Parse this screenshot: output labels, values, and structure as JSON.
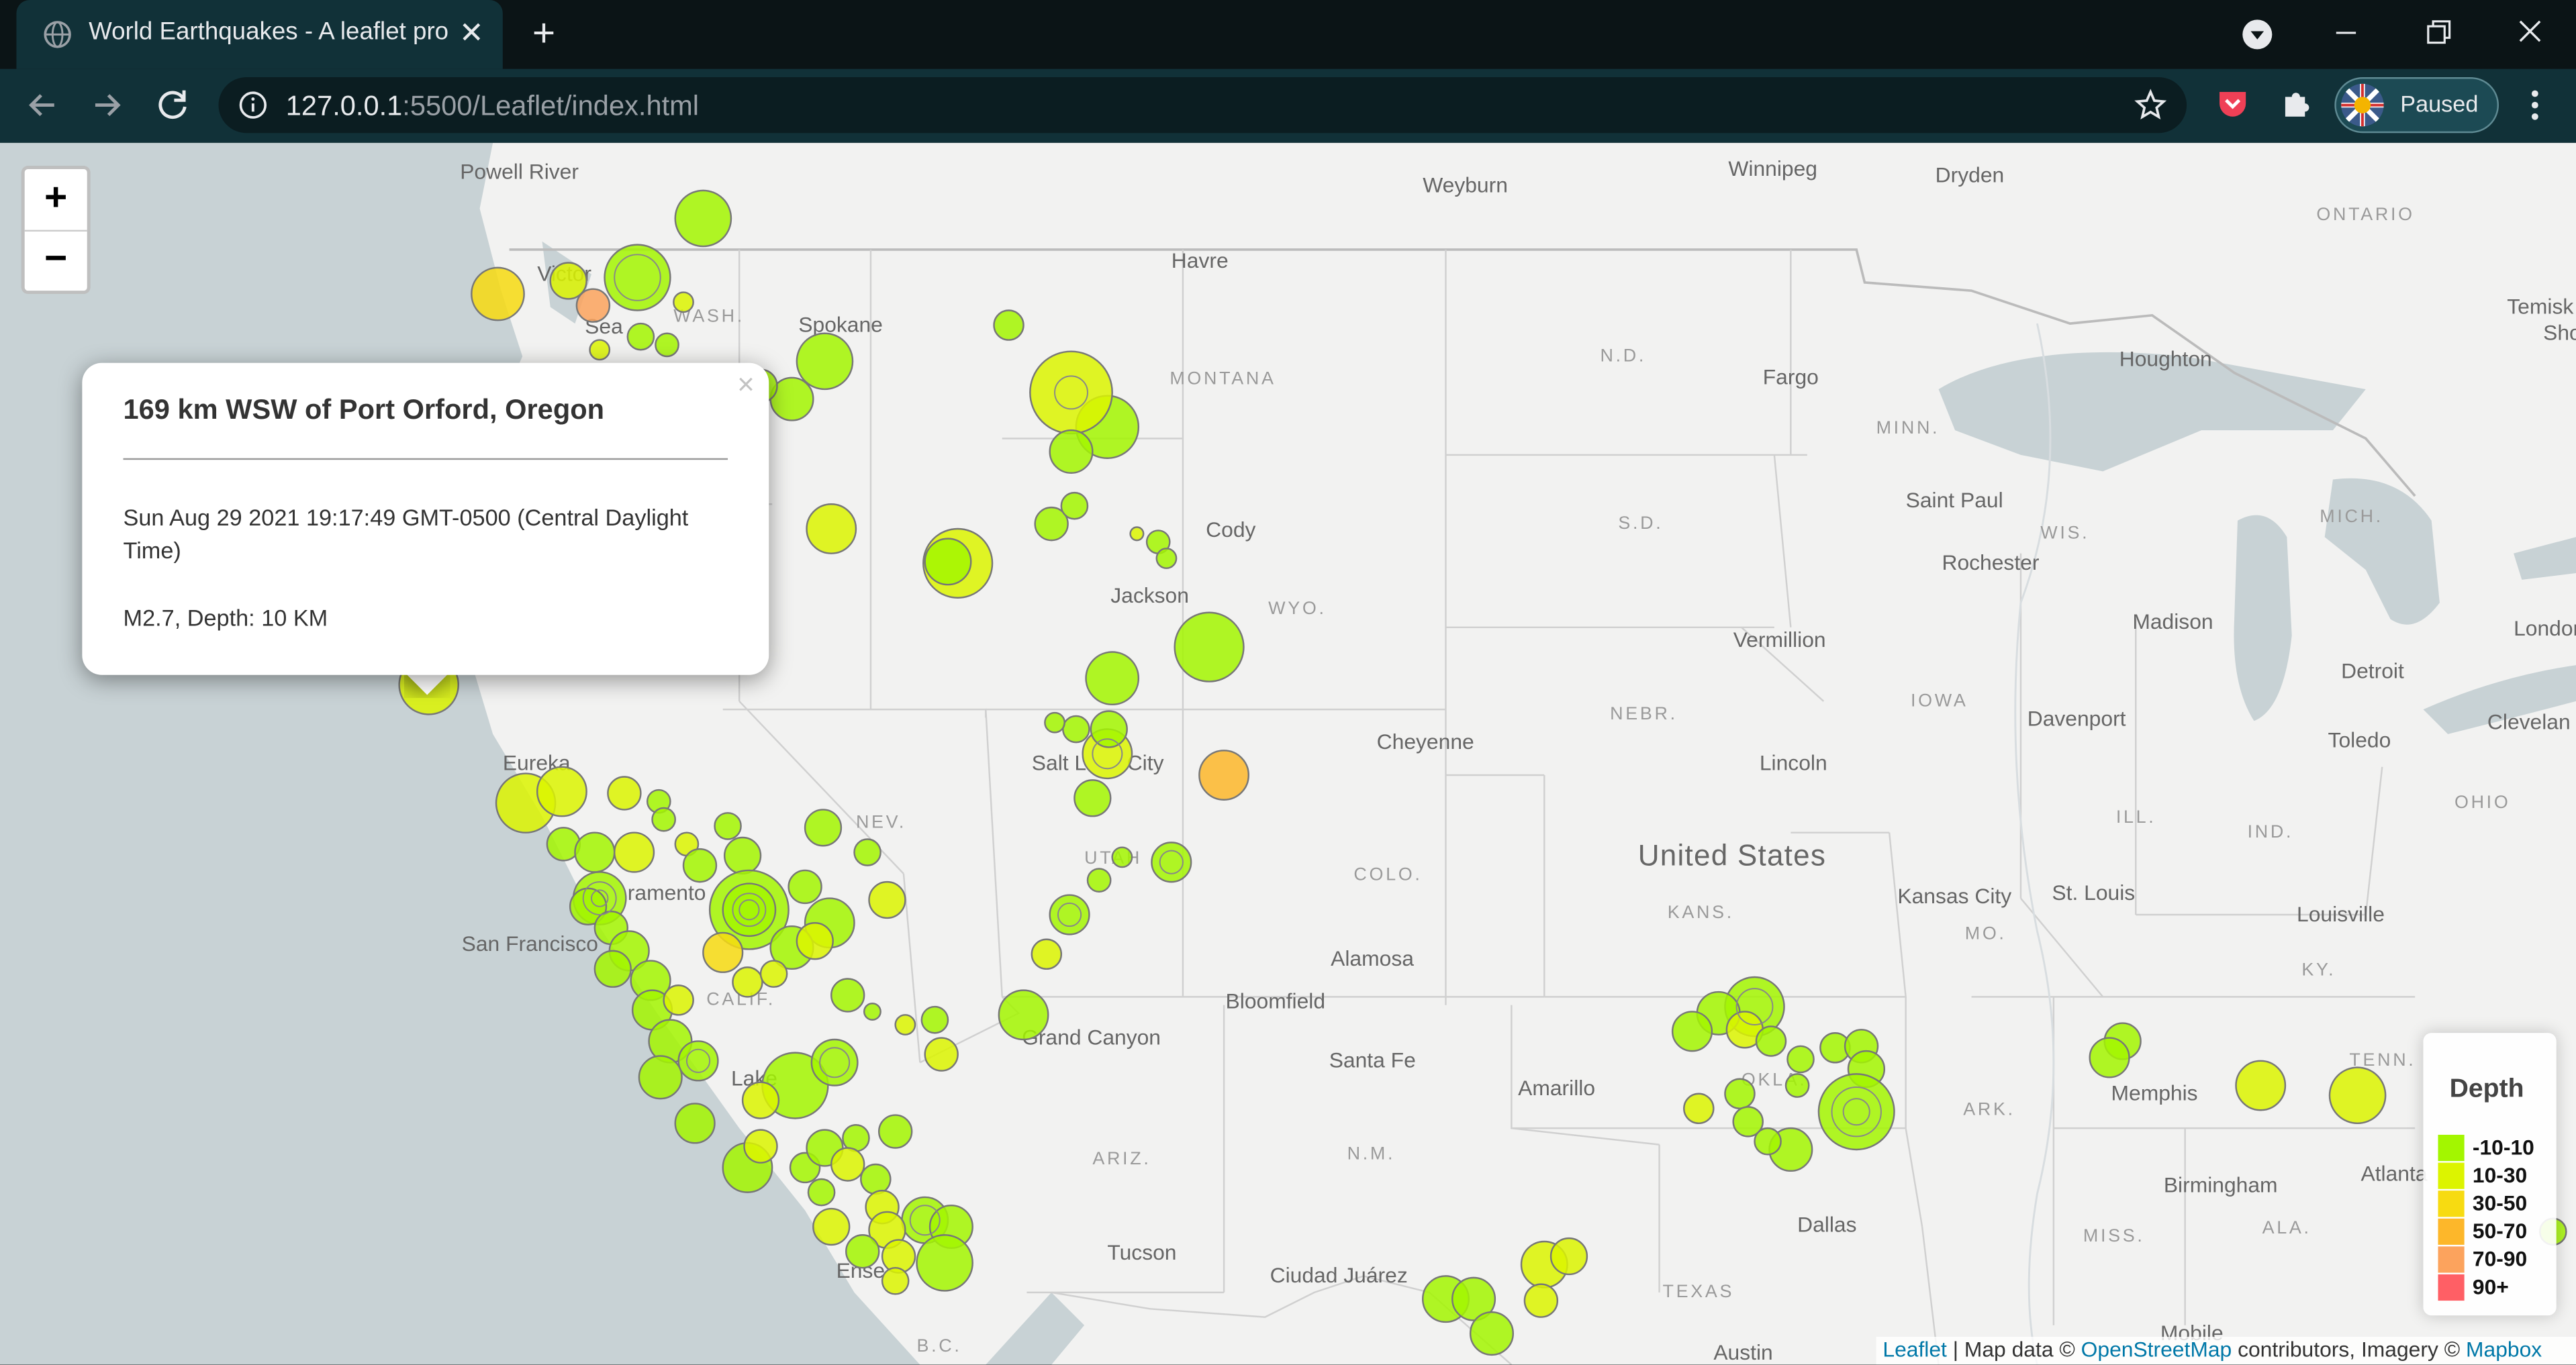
{
  "browser": {
    "tab_title": "World Earthquakes - A leaflet pro",
    "url_host": "127.0.0.1",
    "url_rest": ":5500/Leaflet/index.html",
    "profile_label": "Paused"
  },
  "map": {
    "zoom_in_label": "+",
    "zoom_out_label": "−",
    "labels": {
      "powell_river": "Powell River",
      "victoria": "Victor",
      "seattle": "Sea",
      "wash": "WASH.",
      "spokane": "Spokane",
      "weyburn": "Weyburn",
      "winnipeg": "Winnipeg",
      "dryden": "Dryden",
      "ontario": "ONTARIO",
      "havre": "Havre",
      "montana": "MONTANA",
      "nd": "N.D.",
      "fargo": "Fargo",
      "minn": "MINN.",
      "houghton": "Houghton",
      "temisk": "Temisk",
      "sho": "Sho",
      "cody": "Cody",
      "saint_paul": "Saint Paul",
      "sd": "S.D.",
      "wis": "WIS.",
      "mich": "MICH.",
      "rochester": "Rochester",
      "jackson": "Jackson",
      "wyo": "WYO.",
      "vermillion": "Vermillion",
      "madison": "Madison",
      "london": "London",
      "detroit": "Detroit",
      "nebr": "NEBR.",
      "iowa": "IOWA",
      "cleveland": "Clevelan",
      "eureka": "Eureka",
      "salt_lake": "Salt L",
      "city": "City",
      "cheyenne": "Cheyenne",
      "davenport": "Davenport",
      "toledo": "Toledo",
      "lincoln": "Lincoln",
      "ohio": "OHIO",
      "nev": "NEV.",
      "ill": "ILL.",
      "ind": "IND.",
      "united_states": "United States",
      "sacramento": "ramento",
      "utah": "UTAH",
      "colo": "COLO.",
      "kans": "KANS.",
      "kansas_city": "Kansas City",
      "st_louis": "St. Louis",
      "louisville": "Louisville",
      "san_francisco": "San Francisco",
      "mo": "MO.",
      "calif": "CALIF.",
      "alamosa": "Alamosa",
      "ky": "KY.",
      "bloomfield": "Bloomfield",
      "grand_canyon": "Grand Canyon",
      "santa_fe": "Santa Fe",
      "amarillo": "Amarillo",
      "tenn": "TENN.",
      "memphis": "Memphis",
      "las_vegas": "Lake",
      "ark": "ARK.",
      "nm": "N.M.",
      "ariz": "ARIZ.",
      "okla": "OKLA.",
      "atlanta": "Atlanta",
      "birmingham": "Birmingham",
      "dallas": "Dallas",
      "miss": "MISS.",
      "ala": "ALA.",
      "tucson": "Tucson",
      "texas": "TEXAS",
      "ciudad_juarez": "Ciudad Juárez",
      "ensenada": "Ense",
      "bc": "B.C.",
      "austin": "Austin",
      "mobile": "Mobile"
    }
  },
  "popup": {
    "title": "169 km WSW of Port Orford, Oregon",
    "close_label": "×",
    "time_text": "Sun Aug 29 2021 19:17:49 GMT-0500 (Central Daylight Time)",
    "mag_text": "M2.7, Depth: 10 KM"
  },
  "legend": {
    "title": "Depth",
    "items": [
      {
        "label": "-10-10",
        "color": "#a3f600"
      },
      {
        "label": "10-30",
        "color": "#dcf400"
      },
      {
        "label": "30-50",
        "color": "#f7db11"
      },
      {
        "label": "50-70",
        "color": "#fdb72a"
      },
      {
        "label": "70-90",
        "color": "#fca35d"
      },
      {
        "label": "90+",
        "color": "#ff5f65"
      }
    ]
  },
  "attribution": {
    "leaflet": "Leaflet",
    "sep": " | Map data © ",
    "osm": "OpenStreetMap",
    "mid": " contributors, Imagery © ",
    "mapbox": "Mapbox"
  },
  "colors": {
    "shallow": "#a3f600",
    "mid_shallow": "#dcf400",
    "medium": "#f7db11",
    "medium_deep": "#fdb72a",
    "deep": "#fca35d",
    "deepest": "#ff5f65",
    "tab_bg": "#113138",
    "water": "#c8d2d5",
    "land": "#f2f2f1"
  }
}
